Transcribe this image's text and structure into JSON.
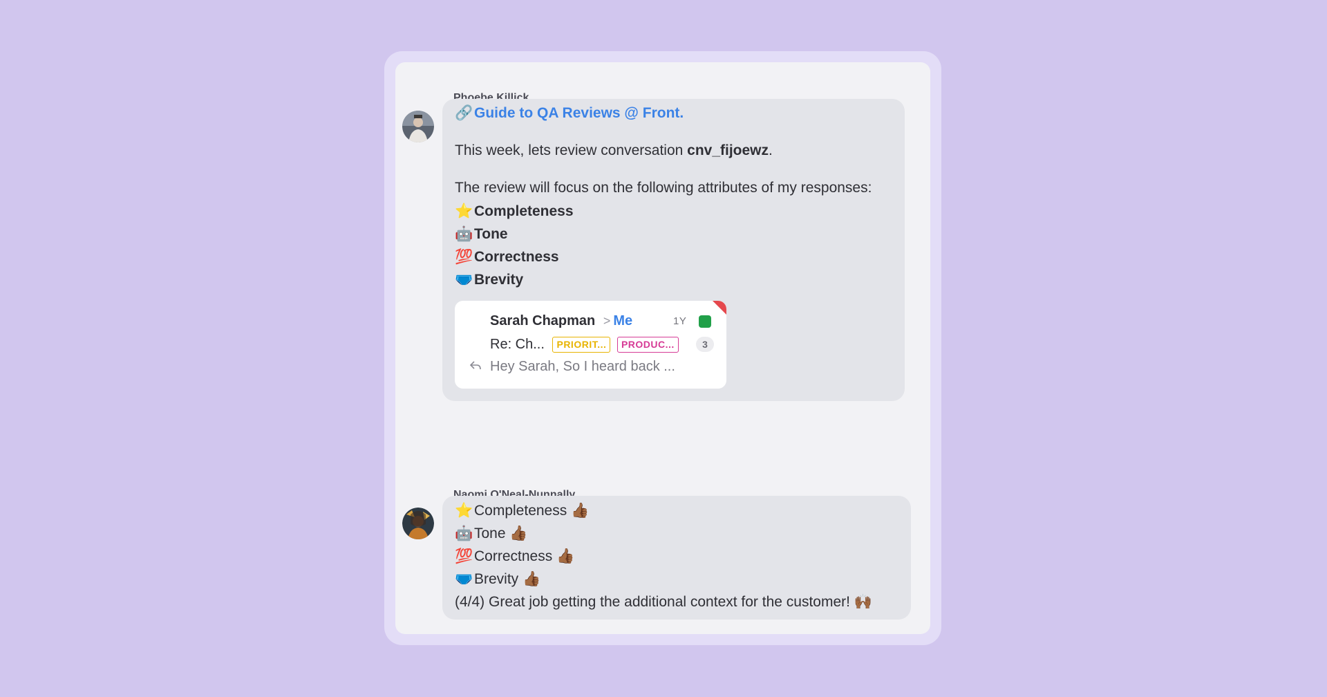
{
  "messages": [
    {
      "sender": "Phoebe Killick",
      "link": {
        "icon": "🔗",
        "text": "Guide to QA Reviews @ Front."
      },
      "intro_prefix": "This week, lets review conversation ",
      "intro_code": "cnv_fijoewz",
      "intro_suffix": ".",
      "focus_text": "The review will focus on the following attributes of my responses:",
      "attributes": [
        {
          "emoji": "⭐",
          "icon": "star-icon",
          "label": "Completeness"
        },
        {
          "emoji": "🤖",
          "icon": "robot-icon",
          "label": "Tone"
        },
        {
          "emoji": "💯",
          "icon": "hundred-points-icon",
          "label": "Correctness"
        },
        {
          "emoji": "🩲",
          "icon": "briefs-icon",
          "label": "Brevity"
        }
      ],
      "conversation_card": {
        "from": "Sarah Chapman",
        "separator": ">",
        "to": "Me",
        "age": "1Y",
        "status_color": "#21a049",
        "subject": "Re: Ch...",
        "tags": [
          {
            "label": "PRIORIT...",
            "color": "#e8b400"
          },
          {
            "label": "PRODUC...",
            "color": "#d63a95"
          }
        ],
        "count": "3",
        "preview": "Hey Sarah, So I heard back ..."
      }
    },
    {
      "sender": "Naomi O'Neal-Nunnally",
      "ratings": [
        {
          "emoji": "⭐",
          "label": "Completeness",
          "reaction": "👍🏾"
        },
        {
          "emoji": "🤖",
          "label": "Tone",
          "reaction": "👍🏾"
        },
        {
          "emoji": "💯",
          "label": "Correctness",
          "reaction": "👍🏾"
        },
        {
          "emoji": "🩲",
          "label": "Brevity",
          "reaction": "👍🏾"
        }
      ],
      "summary": "(4/4) Great job getting the additional context for the customer!",
      "summary_reaction": "🙌🏾"
    }
  ],
  "colors": {
    "background": "#d1c6ee",
    "bubble": "#e3e4e9",
    "link": "#3b82e6"
  }
}
